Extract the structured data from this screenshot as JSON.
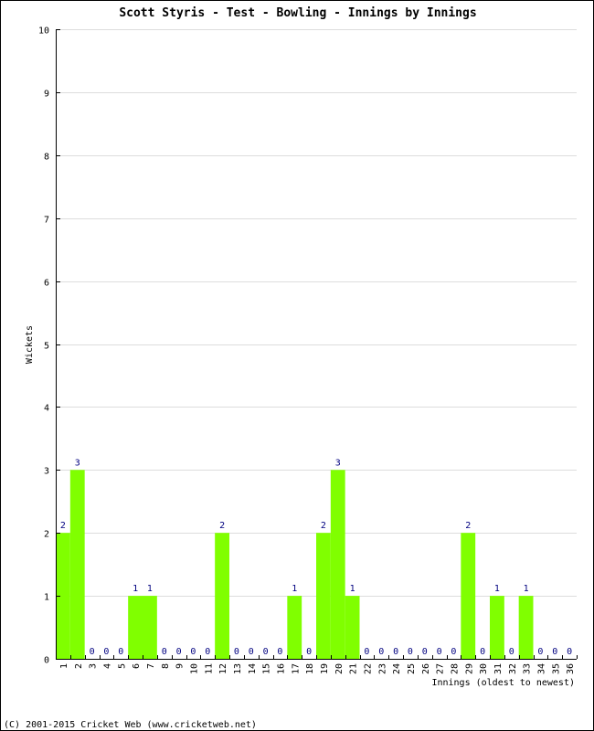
{
  "chart_data": {
    "type": "bar",
    "title": "Scott Styris - Test - Bowling - Innings by Innings",
    "xlabel": "Innings (oldest to newest)",
    "ylabel": "Wickets",
    "ylim": [
      0,
      10
    ],
    "yticks": [
      "0",
      "1",
      "2",
      "3",
      "4",
      "5",
      "6",
      "7",
      "8",
      "9",
      "10"
    ],
    "grid": true,
    "categories": [
      "1",
      "2",
      "3",
      "4",
      "5",
      "6",
      "7",
      "8",
      "9",
      "10",
      "11",
      "12",
      "13",
      "14",
      "15",
      "16",
      "17",
      "18",
      "19",
      "20",
      "21",
      "22",
      "23",
      "24",
      "25",
      "26",
      "27",
      "28",
      "29",
      "30",
      "31",
      "32",
      "33",
      "34",
      "35",
      "36"
    ],
    "values": [
      2,
      3,
      0,
      0,
      0,
      1,
      1,
      0,
      0,
      0,
      0,
      2,
      0,
      0,
      0,
      0,
      1,
      0,
      2,
      3,
      1,
      0,
      0,
      0,
      0,
      0,
      0,
      0,
      2,
      0,
      1,
      0,
      1,
      0,
      0,
      0
    ],
    "bar_color": "#80ff00",
    "label_color": "#000080",
    "grid_color": "#dddddd"
  },
  "footer": "(C) 2001-2015 Cricket Web (www.cricketweb.net)"
}
